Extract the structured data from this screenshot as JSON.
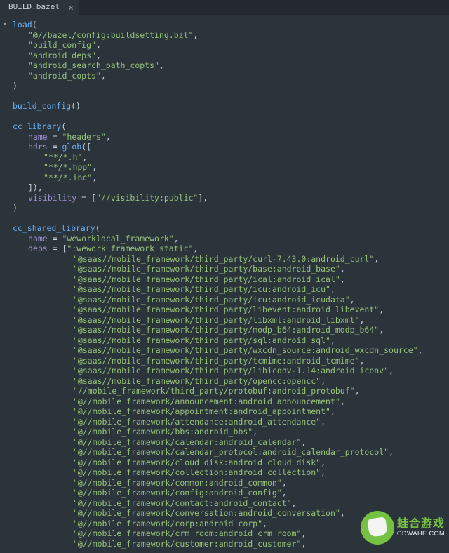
{
  "tab": {
    "title": "BUILD.bazel",
    "close_glyph": "×"
  },
  "fold_glyph": "▾",
  "code": {
    "lines": [
      {
        "indent": 0,
        "kind": "call_open",
        "fn": "load",
        "p": "("
      },
      {
        "indent": 1,
        "kind": "str_item",
        "str": "\"@//bazel/config:buildsetting.bzl\"",
        "trail": ","
      },
      {
        "indent": 1,
        "kind": "str_item",
        "str": "\"build_config\"",
        "trail": ","
      },
      {
        "indent": 1,
        "kind": "str_item",
        "str": "\"android_deps\"",
        "trail": ","
      },
      {
        "indent": 1,
        "kind": "str_item",
        "str": "\"android_search_path_copts\"",
        "trail": ","
      },
      {
        "indent": 1,
        "kind": "str_item",
        "str": "\"android_copts\"",
        "trail": ","
      },
      {
        "indent": 0,
        "kind": "close",
        "p": ")"
      },
      {
        "indent": 0,
        "kind": "blank"
      },
      {
        "indent": 0,
        "kind": "call_empty",
        "fn": "build_config",
        "p": "()"
      },
      {
        "indent": 0,
        "kind": "blank"
      },
      {
        "indent": 0,
        "kind": "call_open",
        "fn": "cc_library",
        "p": "("
      },
      {
        "indent": 1,
        "kind": "kv_str",
        "key": "name",
        "op": " = ",
        "str": "\"headers\"",
        "trail": ","
      },
      {
        "indent": 1,
        "kind": "kv_call",
        "key": "hdrs",
        "op": " = ",
        "fn": "glob",
        "p": "(["
      },
      {
        "indent": 2,
        "kind": "str_item",
        "str": "\"**/*.h\"",
        "trail": ","
      },
      {
        "indent": 2,
        "kind": "str_item",
        "str": "\"**/*.hpp\"",
        "trail": ","
      },
      {
        "indent": 2,
        "kind": "str_item",
        "str": "\"**/*.inc\"",
        "trail": ","
      },
      {
        "indent": 1,
        "kind": "close",
        "p": "]),"
      },
      {
        "indent": 1,
        "kind": "kv_list1",
        "key": "visibility",
        "op": " = [",
        "str": "\"//visibility:public\"",
        "trail": "],"
      },
      {
        "indent": 0,
        "kind": "close",
        "p": ")"
      },
      {
        "indent": 0,
        "kind": "blank"
      },
      {
        "indent": 0,
        "kind": "call_open",
        "fn": "cc_shared_library",
        "p": "("
      },
      {
        "indent": 1,
        "kind": "kv_str",
        "key": "name",
        "op": " = ",
        "str": "\"weworklocal_framework\"",
        "trail": ","
      },
      {
        "indent": 1,
        "kind": "kv_listopen",
        "key": "deps",
        "op": " = [",
        "str": "\":wework_framework_static\"",
        "trail": ","
      },
      {
        "indent": 4,
        "kind": "str_item",
        "str": "\"@saas//mobile_framework/third_party/curl-7.43.0:android_curl\"",
        "trail": ","
      },
      {
        "indent": 4,
        "kind": "str_item",
        "str": "\"@saas//mobile_framework/third_party/base:android_base\"",
        "trail": ","
      },
      {
        "indent": 4,
        "kind": "str_item",
        "str": "\"@saas//mobile_framework/third_party/ical:android_ical\"",
        "trail": ","
      },
      {
        "indent": 4,
        "kind": "str_item",
        "str": "\"@saas//mobile_framework/third_party/icu:android_icu\"",
        "trail": ","
      },
      {
        "indent": 4,
        "kind": "str_item",
        "str": "\"@saas//mobile_framework/third_party/icu:android_icudata\"",
        "trail": ","
      },
      {
        "indent": 4,
        "kind": "str_item",
        "str": "\"@saas//mobile_framework/third_party/libevent:android_libevent\"",
        "trail": ","
      },
      {
        "indent": 4,
        "kind": "str_item",
        "str": "\"@saas//mobile_framework/third_party/libxml:android_libxml\"",
        "trail": ","
      },
      {
        "indent": 4,
        "kind": "str_item",
        "str": "\"@saas//mobile_framework/third_party/modp_b64:android_modp_b64\"",
        "trail": ","
      },
      {
        "indent": 4,
        "kind": "str_item",
        "str": "\"@saas//mobile_framework/third_party/sql:android_sql\"",
        "trail": ","
      },
      {
        "indent": 4,
        "kind": "str_item",
        "str": "\"@saas//mobile_framework/third_party/wxcdn_source:android_wxcdn_source\"",
        "trail": ","
      },
      {
        "indent": 4,
        "kind": "str_item",
        "str": "\"@saas//mobile_framework/third_party/tcmime:android_tcmime\"",
        "trail": ","
      },
      {
        "indent": 4,
        "kind": "str_item",
        "str": "\"@saas//mobile_framework/third_party/libiconv-1.14:android_iconv\"",
        "trail": ","
      },
      {
        "indent": 4,
        "kind": "str_item",
        "str": "\"@saas//mobile_framework/third_party/opencc:opencc\"",
        "trail": ","
      },
      {
        "indent": 4,
        "kind": "str_item",
        "str": "\"//mobile_framework/third_party/protobuf:android_protobuf\"",
        "trail": ","
      },
      {
        "indent": 4,
        "kind": "str_item",
        "str": "\"@//mobile_framework/announcement:android_announcement\"",
        "trail": ","
      },
      {
        "indent": 4,
        "kind": "str_item",
        "str": "\"@//mobile_framework/appointment:android_appointment\"",
        "trail": ","
      },
      {
        "indent": 4,
        "kind": "str_item",
        "str": "\"@//mobile_framework/attendance:android_attendance\"",
        "trail": ","
      },
      {
        "indent": 4,
        "kind": "str_item",
        "str": "\"@//mobile_framework/bbs:android_bbs\"",
        "trail": ","
      },
      {
        "indent": 4,
        "kind": "str_item",
        "str": "\"@//mobile_framework/calendar:android_calendar\"",
        "trail": ","
      },
      {
        "indent": 4,
        "kind": "str_item",
        "str": "\"@//mobile_framework/calendar_protocol:android_calendar_protocol\"",
        "trail": ","
      },
      {
        "indent": 4,
        "kind": "str_item",
        "str": "\"@//mobile_framework/cloud_disk:android_cloud_disk\"",
        "trail": ","
      },
      {
        "indent": 4,
        "kind": "str_item",
        "str": "\"@//mobile_framework/collection:android_collection\"",
        "trail": ","
      },
      {
        "indent": 4,
        "kind": "str_item",
        "str": "\"@//mobile_framework/common:android_common\"",
        "trail": ","
      },
      {
        "indent": 4,
        "kind": "str_item",
        "str": "\"@//mobile_framework/config:android_config\"",
        "trail": ","
      },
      {
        "indent": 4,
        "kind": "str_item",
        "str": "\"@//mobile_framework/contact:android_contact\"",
        "trail": ","
      },
      {
        "indent": 4,
        "kind": "str_item",
        "str": "\"@//mobile_framework/conversation:android_conversation\"",
        "trail": ","
      },
      {
        "indent": 4,
        "kind": "str_item",
        "str": "\"@//mobile_framework/corp:android_corp\"",
        "trail": ","
      },
      {
        "indent": 4,
        "kind": "str_item",
        "str": "\"@//mobile_framework/crm_room:android_crm_room\"",
        "trail": ","
      },
      {
        "indent": 4,
        "kind": "str_item",
        "str": "\"@//mobile_framework/customer:android_customer\"",
        "trail": ","
      }
    ]
  },
  "watermark": {
    "title": "蛙合游戏",
    "url": "CDWAHE.COM"
  }
}
